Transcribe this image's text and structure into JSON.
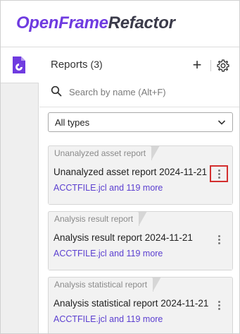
{
  "app": {
    "brand_part1": "OpenFrame",
    "brand_part2": "Refactor"
  },
  "rail": {
    "active_item_icon": "report-file-icon"
  },
  "panel": {
    "title": "Reports",
    "count": "(3)",
    "add_label": "+",
    "search_placeholder": "Search by name (Alt+F)",
    "search_value": "",
    "type_filter": {
      "selected": "All types"
    }
  },
  "reports": [
    {
      "category": "Unanalyzed asset report",
      "title": "Unanalyzed asset report 2024-11-21",
      "files": "ACCTFILE.jcl and 119 more",
      "more_highlighted": true
    },
    {
      "category": "Analysis result report",
      "title": "Analysis result report 2024-11-21",
      "files": "ACCTFILE.jcl and 119 more",
      "more_highlighted": false
    },
    {
      "category": "Analysis statistical report",
      "title": "Analysis statistical report 2024-11-21",
      "files": "ACCTFILE.jcl and 119 more",
      "more_highlighted": false
    }
  ],
  "colors": {
    "brand_primary": "#6f3be0",
    "brand_secondary": "#3b3b4a",
    "link": "#5b3fd0",
    "highlight": "#d32f2f"
  }
}
